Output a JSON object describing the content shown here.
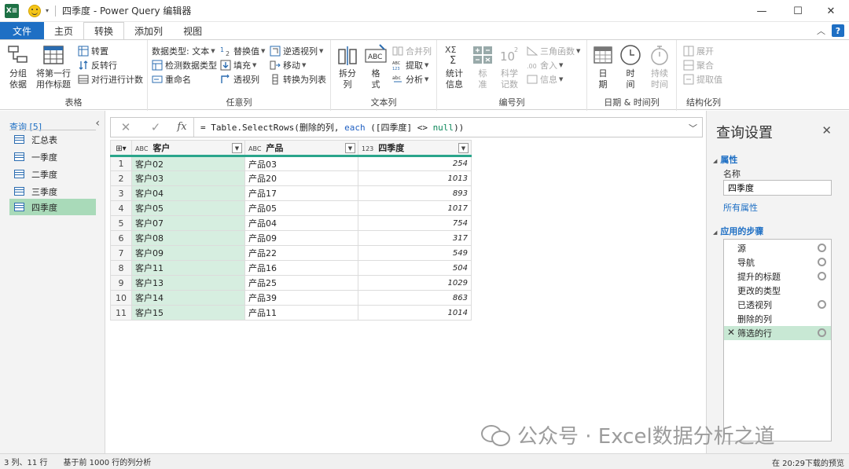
{
  "window": {
    "title": "四季度 - Power Query 编辑器",
    "excel_logo": "X≡",
    "min": "—",
    "max": "☐",
    "close": "✕"
  },
  "tabs": [
    {
      "label": "文件"
    },
    {
      "label": "主页"
    },
    {
      "label": "转换"
    },
    {
      "label": "添加列"
    },
    {
      "label": "视图"
    }
  ],
  "ribbon": {
    "table_group": {
      "label": "表格",
      "group_by": "分组\n依据",
      "use_first_row": "将第一行\n用作标题",
      "transpose": "转置",
      "reverse_rows": "反转行",
      "count_rows": "对行进行计数"
    },
    "any_column": {
      "label": "任意列",
      "data_type": "数据类型: 文本",
      "detect_type": "检测数据类型",
      "rename": "重命名",
      "replace_values": "替换值",
      "fill": "填充",
      "pivot": "透视列",
      "unpivot": "逆透视列",
      "move": "移动",
      "to_list": "转换为列表"
    },
    "text_column": {
      "label": "文本列",
      "split": "拆分\n列",
      "format": "格\n式",
      "merge": "合并列",
      "extract": "提取",
      "parse": "分析"
    },
    "number_column": {
      "label": "编号列",
      "statistics": "统计\n信息",
      "standard": "标\n准",
      "scientific": "科学\n记数",
      "trig": "三角函数",
      "rounding": "舍入",
      "information": "信息"
    },
    "datetime": {
      "label": "日期 & 时间列",
      "date": "日\n期",
      "time": "时\n间",
      "duration": "持续\n时间"
    },
    "structured": {
      "label": "结构化列",
      "expand": "展开",
      "aggregate": "聚合",
      "extract_values": "提取值"
    }
  },
  "query_pane": {
    "header": "查询 [5]",
    "items": [
      {
        "label": "汇总表"
      },
      {
        "label": "一季度"
      },
      {
        "label": "二季度"
      },
      {
        "label": "三季度"
      },
      {
        "label": "四季度"
      }
    ]
  },
  "formula": {
    "prefix": "= Table.SelectRows(删除的列, ",
    "keyword": "each",
    "middle": " ([四季度] <> ",
    "null_kw": "null",
    "suffix": "))"
  },
  "grid": {
    "columns": [
      {
        "type": "ABC",
        "name": "客户"
      },
      {
        "type": "ABC",
        "name": "产品"
      },
      {
        "type": "123",
        "name": "四季度"
      }
    ],
    "rows": [
      [
        "1",
        "客户02",
        "产品03",
        "254"
      ],
      [
        "2",
        "客户03",
        "产品20",
        "1013"
      ],
      [
        "3",
        "客户04",
        "产品17",
        "893"
      ],
      [
        "4",
        "客户05",
        "产品05",
        "1017"
      ],
      [
        "5",
        "客户07",
        "产品04",
        "754"
      ],
      [
        "6",
        "客户08",
        "产品09",
        "317"
      ],
      [
        "7",
        "客户09",
        "产品22",
        "549"
      ],
      [
        "8",
        "客户11",
        "产品16",
        "504"
      ],
      [
        "9",
        "客户13",
        "产品25",
        "1029"
      ],
      [
        "10",
        "客户14",
        "产品39",
        "863"
      ],
      [
        "11",
        "客户15",
        "产品11",
        "1014"
      ]
    ]
  },
  "settings": {
    "title": "查询设置",
    "properties": "属性",
    "name_label": "名称",
    "name_value": "四季度",
    "all_properties": "所有属性",
    "applied_steps": "应用的步骤",
    "steps": [
      {
        "label": "源",
        "gear": true
      },
      {
        "label": "导航",
        "gear": true
      },
      {
        "label": "提升的标题",
        "gear": true
      },
      {
        "label": "更改的类型",
        "gear": false
      },
      {
        "label": "已透视列",
        "gear": true
      },
      {
        "label": "删除的列",
        "gear": false
      },
      {
        "label": "筛选的行",
        "gear": true
      }
    ]
  },
  "watermark": "公众号 · Excel数据分析之道",
  "status": {
    "left": "3 列、11 行",
    "middle": "基于前 1000 行的列分析",
    "right": "在 20:29下载的预览"
  },
  "colors": {
    "file_tab": "#1e6fc4",
    "selected_query": "#a9dab9",
    "teal_header": "#2aa58b"
  }
}
